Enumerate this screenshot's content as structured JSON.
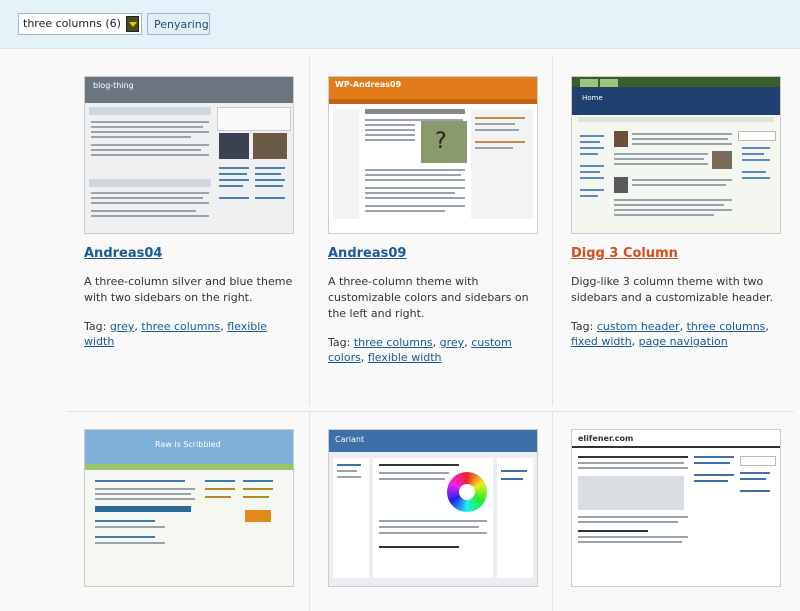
{
  "filter": {
    "selected": "three columns (6)",
    "button_label": "Penyaring"
  },
  "themes": [
    {
      "title": "Andreas04",
      "description": "A three-column silver and blue theme with two sidebars on the right.",
      "tag_label": "Tag:",
      "tags": [
        "grey",
        "three columns",
        "flexible width"
      ],
      "screenshot_text": "blog-thing"
    },
    {
      "title": "Andreas09",
      "description": "A three-column theme with customizable colors and sidebars on the left and right.",
      "tag_label": "Tag:",
      "tags": [
        "three columns",
        "grey",
        "custom colors",
        "flexible width"
      ],
      "screenshot_text": "WP-Andreas09"
    },
    {
      "title": "Digg 3 Column",
      "description": "Digg-like 3 column theme with two sidebars and a customizable header.",
      "tag_label": "Tag:",
      "tags": [
        "custom header",
        "three columns",
        "fixed width",
        "page navigation"
      ],
      "screenshot_text": "Home"
    },
    {
      "screenshot_text": "Raw is Scribbled"
    },
    {
      "screenshot_text": "Cariant"
    },
    {
      "screenshot_text": "elifener.com"
    }
  ],
  "colors": {
    "link": "#1a5a96",
    "active_title": "#d54e21",
    "filter_bg": "#e4f2fa"
  }
}
